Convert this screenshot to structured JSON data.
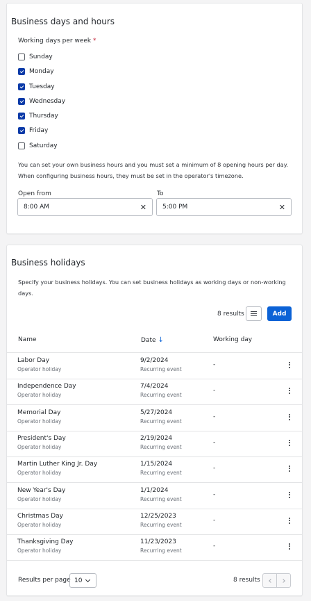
{
  "hours_card": {
    "title": "Business days and hours",
    "days_label": "Working days per week",
    "required_mark": "*",
    "days": [
      {
        "label": "Sunday",
        "checked": false
      },
      {
        "label": "Monday",
        "checked": true
      },
      {
        "label": "Tuesday",
        "checked": true
      },
      {
        "label": "Wednesday",
        "checked": true
      },
      {
        "label": "Thursday",
        "checked": true
      },
      {
        "label": "Friday",
        "checked": true
      },
      {
        "label": "Saturday",
        "checked": false
      }
    ],
    "help_line1": "You can set your own business hours and you must set a minimum of 8 opening hours per day.",
    "help_line2": "When configuring business hours, they must be set in the operator's timezone.",
    "open_from_label": "Open from",
    "open_from_value": "8:00 AM",
    "to_label": "To",
    "to_value": "5:00 PM"
  },
  "holidays_card": {
    "title": "Business holidays",
    "description_line1": "Specify your business holidays. You can set business holidays as working days or non-working",
    "description_line2": "days.",
    "results_count": "8 results",
    "add_label": "Add",
    "columns": {
      "name": "Name",
      "date": "Date",
      "working_day": "Working day"
    },
    "rows": [
      {
        "name": "Labor Day",
        "type": "Operator holiday",
        "date": "9/2/2024",
        "recurrence": "Recurring event",
        "working_day": "-"
      },
      {
        "name": "Independence Day",
        "type": "Operator holiday",
        "date": "7/4/2024",
        "recurrence": "Recurring event",
        "working_day": "-"
      },
      {
        "name": "Memorial Day",
        "type": "Operator holiday",
        "date": "5/27/2024",
        "recurrence": "Recurring event",
        "working_day": "-"
      },
      {
        "name": "President's Day",
        "type": "Operator holiday",
        "date": "2/19/2024",
        "recurrence": "Recurring event",
        "working_day": "-"
      },
      {
        "name": "Martin Luther King Jr. Day",
        "type": "Operator holiday",
        "date": "1/15/2024",
        "recurrence": "Recurring event",
        "working_day": "-"
      },
      {
        "name": "New Year's Day",
        "type": "Operator holiday",
        "date": "1/1/2024",
        "recurrence": "Recurring event",
        "working_day": "-"
      },
      {
        "name": "Christmas Day",
        "type": "Operator holiday",
        "date": "12/25/2023",
        "recurrence": "Recurring event",
        "working_day": "-"
      },
      {
        "name": "Thanksgiving Day",
        "type": "Operator holiday",
        "date": "11/23/2023",
        "recurrence": "Recurring event",
        "working_day": "-"
      }
    ],
    "footer": {
      "results_per_page_label": "Results per page",
      "per_page_value": "10",
      "results_count": "8 results"
    }
  },
  "colors": {
    "primary": "#0b62d6",
    "checkbox_checked": "#0b3aa8",
    "required": "#c6283c",
    "background": "#f4f4f5"
  }
}
